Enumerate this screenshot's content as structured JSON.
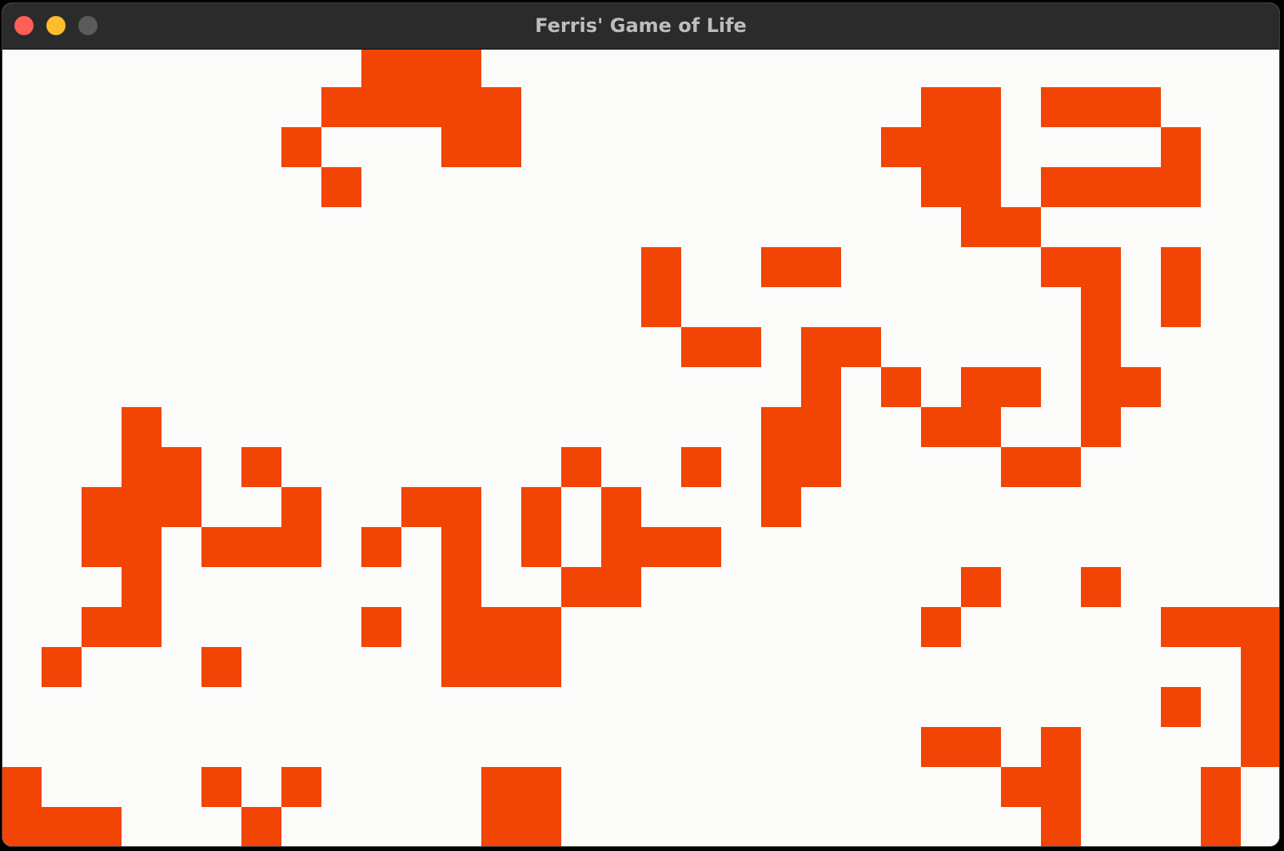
{
  "window": {
    "title": "Ferris' Game of Life",
    "buttons": [
      {
        "name": "close-button",
        "color": "#fe5f57"
      },
      {
        "name": "minimize-button",
        "color": "#febc2e"
      },
      {
        "name": "zoom-button",
        "color": "#5a5a5a"
      }
    ]
  },
  "board": {
    "alive_color": "#f24405",
    "dead_color": "#fbfbf9",
    "rows": 20,
    "cols": 32,
    "alive_cells": [
      [
        0,
        9
      ],
      [
        0,
        10
      ],
      [
        0,
        11
      ],
      [
        1,
        8
      ],
      [
        1,
        9
      ],
      [
        1,
        10
      ],
      [
        1,
        11
      ],
      [
        1,
        12
      ],
      [
        1,
        23
      ],
      [
        1,
        24
      ],
      [
        1,
        26
      ],
      [
        1,
        27
      ],
      [
        1,
        28
      ],
      [
        2,
        7
      ],
      [
        2,
        11
      ],
      [
        2,
        12
      ],
      [
        2,
        22
      ],
      [
        2,
        23
      ],
      [
        2,
        24
      ],
      [
        2,
        29
      ],
      [
        3,
        8
      ],
      [
        3,
        23
      ],
      [
        3,
        24
      ],
      [
        3,
        26
      ],
      [
        3,
        27
      ],
      [
        3,
        28
      ],
      [
        3,
        29
      ],
      [
        4,
        24
      ],
      [
        4,
        25
      ],
      [
        5,
        16
      ],
      [
        5,
        19
      ],
      [
        5,
        20
      ],
      [
        5,
        26
      ],
      [
        5,
        27
      ],
      [
        5,
        29
      ],
      [
        6,
        16
      ],
      [
        6,
        27
      ],
      [
        6,
        29
      ],
      [
        7,
        17
      ],
      [
        7,
        18
      ],
      [
        7,
        20
      ],
      [
        7,
        21
      ],
      [
        7,
        27
      ],
      [
        8,
        20
      ],
      [
        8,
        22
      ],
      [
        8,
        24
      ],
      [
        8,
        25
      ],
      [
        8,
        27
      ],
      [
        8,
        28
      ],
      [
        9,
        3
      ],
      [
        9,
        19
      ],
      [
        9,
        20
      ],
      [
        9,
        23
      ],
      [
        9,
        24
      ],
      [
        9,
        27
      ],
      [
        10,
        3
      ],
      [
        10,
        4
      ],
      [
        10,
        6
      ],
      [
        10,
        14
      ],
      [
        10,
        17
      ],
      [
        10,
        19
      ],
      [
        10,
        20
      ],
      [
        10,
        25
      ],
      [
        10,
        26
      ],
      [
        11,
        2
      ],
      [
        11,
        3
      ],
      [
        11,
        4
      ],
      [
        11,
        7
      ],
      [
        11,
        10
      ],
      [
        11,
        11
      ],
      [
        11,
        13
      ],
      [
        11,
        15
      ],
      [
        11,
        19
      ],
      [
        12,
        2
      ],
      [
        12,
        3
      ],
      [
        12,
        5
      ],
      [
        12,
        6
      ],
      [
        12,
        7
      ],
      [
        12,
        9
      ],
      [
        12,
        11
      ],
      [
        12,
        13
      ],
      [
        12,
        15
      ],
      [
        12,
        16
      ],
      [
        12,
        17
      ],
      [
        13,
        3
      ],
      [
        13,
        11
      ],
      [
        13,
        14
      ],
      [
        13,
        15
      ],
      [
        13,
        24
      ],
      [
        13,
        27
      ],
      [
        14,
        2
      ],
      [
        14,
        3
      ],
      [
        14,
        9
      ],
      [
        14,
        11
      ],
      [
        14,
        12
      ],
      [
        14,
        13
      ],
      [
        14,
        23
      ],
      [
        14,
        29
      ],
      [
        14,
        30
      ],
      [
        14,
        31
      ],
      [
        15,
        1
      ],
      [
        15,
        5
      ],
      [
        15,
        11
      ],
      [
        15,
        12
      ],
      [
        15,
        13
      ],
      [
        15,
        31
      ],
      [
        16,
        29
      ],
      [
        16,
        31
      ],
      [
        17,
        23
      ],
      [
        17,
        24
      ],
      [
        17,
        26
      ],
      [
        17,
        31
      ],
      [
        18,
        0
      ],
      [
        18,
        5
      ],
      [
        18,
        7
      ],
      [
        18,
        12
      ],
      [
        18,
        13
      ],
      [
        18,
        25
      ],
      [
        18,
        26
      ],
      [
        18,
        30
      ],
      [
        19,
        0
      ],
      [
        19,
        1
      ],
      [
        19,
        2
      ],
      [
        19,
        6
      ],
      [
        19,
        12
      ],
      [
        19,
        13
      ],
      [
        19,
        26
      ],
      [
        19,
        30
      ]
    ]
  }
}
